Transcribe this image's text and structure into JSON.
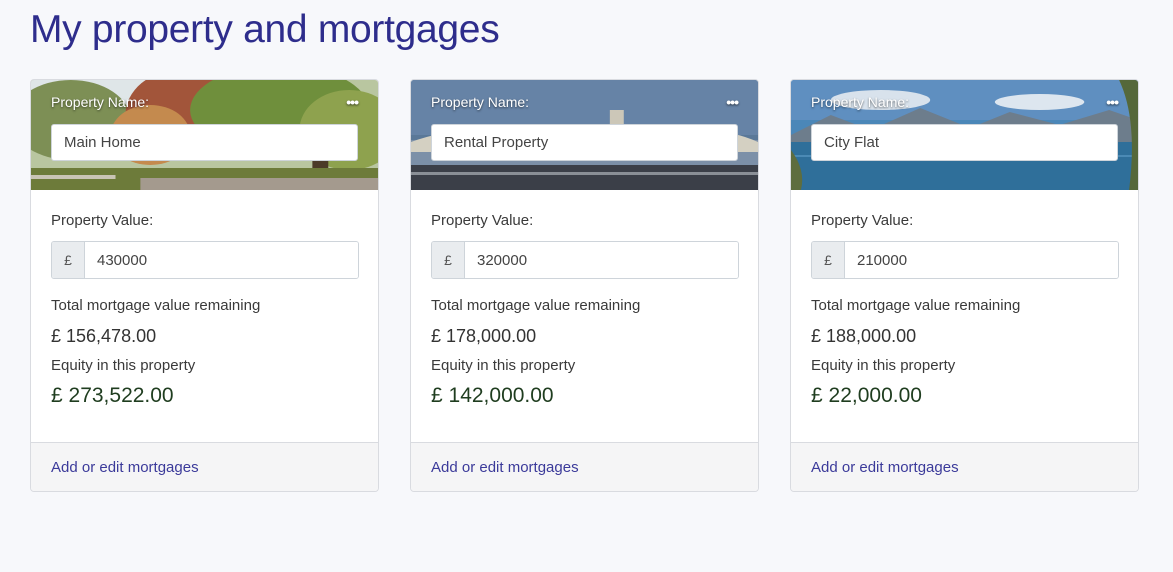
{
  "page": {
    "title": "My property and mortgages"
  },
  "labels": {
    "property_name": "Property Name:",
    "property_value": "Property Value:",
    "currency_symbol": "£",
    "mortgage_remaining": "Total mortgage value remaining",
    "equity": "Equity in this property",
    "edit_link": "Add or edit mortgages",
    "more_icon": "•••"
  },
  "properties": [
    {
      "name": "Main Home",
      "value": "430000",
      "mortgage_remaining": "£ 156,478.00",
      "equity": "£ 273,522.00",
      "image": "park-trees-photo"
    },
    {
      "name": "Rental Property",
      "value": "320000",
      "mortgage_remaining": "£ 178,000.00",
      "equity": "£ 142,000.00",
      "image": "bridge-river-photo"
    },
    {
      "name": "City Flat",
      "value": "210000",
      "mortgage_remaining": "£ 188,000.00",
      "equity": "£ 22,000.00",
      "image": "mountain-lake-photo"
    }
  ],
  "colors": {
    "title": "#2e2d8c",
    "link": "#3b3a9a",
    "page_background": "#f7f8fb"
  }
}
